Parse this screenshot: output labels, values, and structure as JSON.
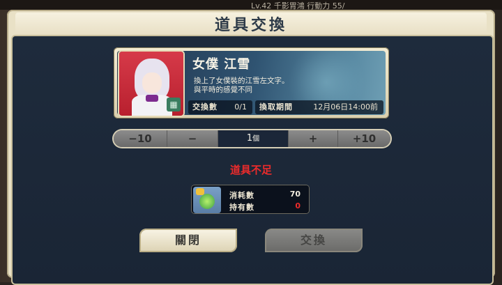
{
  "status_bar": {
    "text": "Lv.42   千影胃鴻  行動力   55/"
  },
  "dialog": {
    "title": "道具交換"
  },
  "item": {
    "name": "女僕 江雪",
    "description_line1": "換上了女僕裝的江雪左文字。",
    "description_line2": "與平時的感覺不同",
    "exchange_count_label": "交換數",
    "exchange_count_value": "0/1",
    "deadline_label": "換取期間",
    "deadline_value": "12月06日14:00前",
    "portrait_icon": "character-portrait"
  },
  "stepper": {
    "minus10": "−10",
    "minus1": "−",
    "quantity": "1",
    "unit": "個",
    "plus1": "+",
    "plus10": "+10"
  },
  "warning": "道具不足",
  "cost": {
    "icon": "potion-item-icon",
    "consume_label": "消耗數",
    "consume_value": "70",
    "owned_label": "持有數",
    "owned_value": "0",
    "owned_color": "#ec2b2b"
  },
  "buttons": {
    "close": "關閉",
    "exchange": "交換"
  }
}
